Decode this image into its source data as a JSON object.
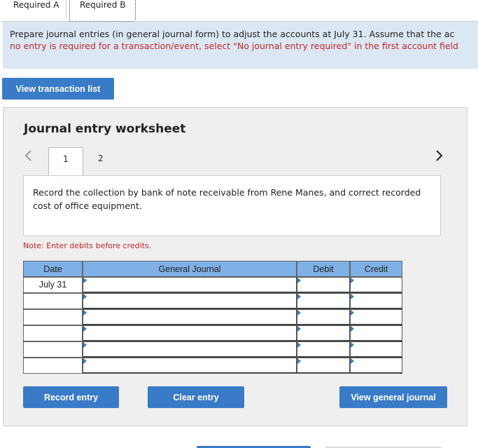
{
  "tabs": [
    {
      "label": "Required A"
    },
    {
      "label": "Required B"
    }
  ],
  "instructions": {
    "line1": "Prepare journal entries (in general journal form) to adjust the accounts at July 31. Assume that the ac",
    "line2": "no entry is required for a transaction/event, select \"No journal entry required\" in the first account field"
  },
  "view_transaction_list_label": "View transaction list",
  "worksheet": {
    "title": "Journal entry worksheet",
    "subtabs": [
      "1",
      "2"
    ],
    "description": "Record the collection by bank of note receivable from Rene Manes, and correct recorded cost of office equipment.",
    "note": "Note: Enter debits before credits.",
    "table": {
      "headers": {
        "date": "Date",
        "journal": "General Journal",
        "debit": "Debit",
        "credit": "Credit"
      },
      "rows": [
        {
          "date": "July 31",
          "journal": "",
          "debit": "",
          "credit": ""
        },
        {
          "date": "",
          "journal": "",
          "debit": "",
          "credit": ""
        },
        {
          "date": "",
          "journal": "",
          "debit": "",
          "credit": ""
        },
        {
          "date": "",
          "journal": "",
          "debit": "",
          "credit": ""
        },
        {
          "date": "",
          "journal": "",
          "debit": "",
          "credit": ""
        },
        {
          "date": "",
          "journal": "",
          "debit": "",
          "credit": ""
        }
      ]
    },
    "buttons": {
      "record": "Record entry",
      "clear": "Clear entry",
      "view_general_journal": "View general journal"
    }
  },
  "colors": {
    "accent": "#3a7bc8",
    "instructions_bg": "#dbe7f3",
    "table_header": "#7fb0e6",
    "error_red": "#c0262c"
  },
  "icons": {
    "prev": "chevron-left-icon",
    "next": "chevron-right-icon"
  }
}
